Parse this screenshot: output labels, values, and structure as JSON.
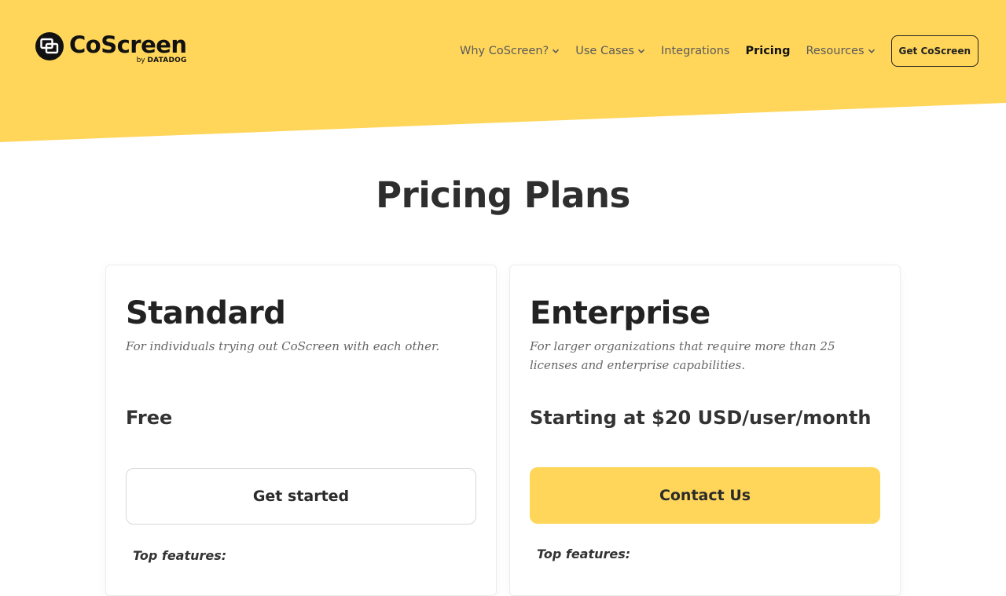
{
  "brand": {
    "name": "CoScreen",
    "byline_prefix": "by",
    "byline_company": "DATADOG",
    "accent": "#FFD65A"
  },
  "nav": {
    "items": [
      {
        "label": "Why CoScreen?",
        "has_dropdown": true,
        "active": false
      },
      {
        "label": "Use Cases",
        "has_dropdown": true,
        "active": false
      },
      {
        "label": "Integrations",
        "has_dropdown": false,
        "active": false
      },
      {
        "label": "Pricing",
        "has_dropdown": false,
        "active": true
      },
      {
        "label": "Resources",
        "has_dropdown": true,
        "active": false
      }
    ],
    "cta_label": "Get CoScreen"
  },
  "main": {
    "title": "Pricing Plans",
    "plans": [
      {
        "name": "Standard",
        "description": "For individuals trying out CoScreen with each other.",
        "price": "Free",
        "button_label": "Get started",
        "features_heading": "Top features:"
      },
      {
        "name": "Enterprise",
        "description": "For larger organizations that require more than 25 licenses and enterprise capabilities.",
        "price": "Starting at $20 USD/user/month",
        "button_label": "Contact Us",
        "features_heading": "Top features:"
      }
    ]
  },
  "icons": {
    "logo": "coscreen-logo-icon",
    "dropdown": "chevron-down-icon"
  }
}
